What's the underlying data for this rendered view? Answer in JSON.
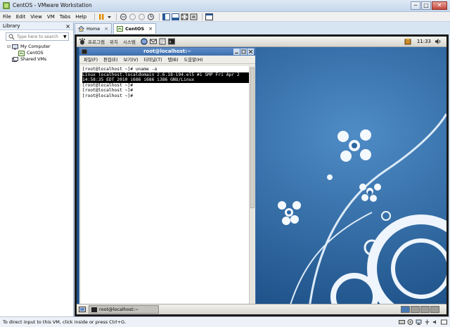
{
  "window": {
    "title": "CentOS - VMware Workstation",
    "min": "─",
    "max": "□",
    "close": "✕"
  },
  "menu": [
    "File",
    "Edit",
    "View",
    "VM",
    "Tabs",
    "Help"
  ],
  "library": {
    "title": "Library",
    "close": "×",
    "search_placeholder": "Type here to search",
    "dropdown": "▼",
    "tree": [
      {
        "label": "My Computer",
        "expander": "⊟",
        "icon": "computer-icon"
      },
      {
        "label": "CentOS",
        "icon": "vm-icon"
      },
      {
        "label": "Shared VMs",
        "icon": "shared-vms-icon"
      }
    ]
  },
  "tabs": [
    {
      "label": "Home",
      "close": "×",
      "icon": "home-icon"
    },
    {
      "label": "CentOS",
      "close": "×",
      "icon": "vm-icon"
    }
  ],
  "gnome": {
    "menus": [
      "프로그램",
      "위치",
      "시스템"
    ],
    "clock": "11:33"
  },
  "terminal": {
    "title": "root@localhost:~",
    "menu": [
      "파일(F)",
      "편집(E)",
      "보기(V)",
      "터미널(T)",
      "탭(B)",
      "도움말(H)"
    ],
    "lines": [
      {
        "text": "[root@localhost ~]# uname -a",
        "hl": false
      },
      {
        "text": "Linux localhost.localdomain 2.6.18-194.el5 #1 SMP Fri Apr 2",
        "hl": true
      },
      {
        "text": " 14:58:35 EDT 2010 i686 i686 i386 GNU/Linux",
        "hl": true
      },
      {
        "text": "[root@localhost ~]#",
        "hl": false
      },
      {
        "text": "[root@localhost ~]#",
        "hl": false
      },
      {
        "text": "[root@localhost ~]#",
        "hl": false
      }
    ]
  },
  "taskbar": {
    "task_label": "root@localhost:~"
  },
  "status": {
    "text": "To direct input to this VM, click inside or press Ctrl+G."
  },
  "colors": {
    "desktop": "#2b69a5",
    "titlebar": "#3e6eae"
  }
}
